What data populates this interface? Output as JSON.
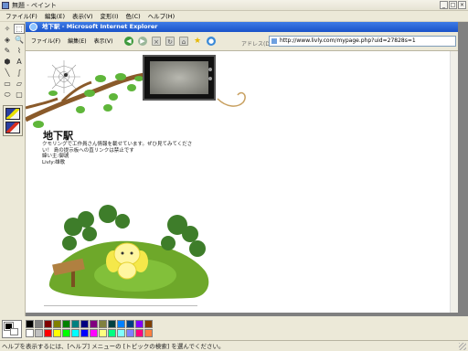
{
  "paint": {
    "title": "無題 - ペイント",
    "window_buttons": [
      "_",
      "□",
      "×"
    ],
    "menu": [
      "ファイル(F)",
      "編集(E)",
      "表示(V)",
      "変形(I)",
      "色(C)",
      "ヘルプ(H)"
    ],
    "tools": [
      "✧",
      "⬚",
      "◈",
      "🔍",
      "✎",
      "⌇",
      "⬢",
      "A",
      "╲",
      "∫",
      "▭",
      "▱",
      "⬭",
      "▢"
    ],
    "status": "ヘルプを表示するには、[ヘルプ] メニューの [トピックの検索] を選んでください。",
    "palette_colors": [
      "#000000",
      "#808080",
      "#800000",
      "#808000",
      "#008000",
      "#008080",
      "#000080",
      "#800080",
      "#808040",
      "#004040",
      "#0080ff",
      "#004080",
      "#8000ff",
      "#804000",
      "#ffffff",
      "#c0c0c0",
      "#ff0000",
      "#ffff00",
      "#00ff00",
      "#00ffff",
      "#0000ff",
      "#ff00ff",
      "#ffff80",
      "#00ff80",
      "#80ffff",
      "#8080ff",
      "#ff0080",
      "#ff8040"
    ]
  },
  "ie": {
    "title": "地下駅 - Microsoft Internet Explorer",
    "menu": [
      "ファイル(F)",
      "編集(E)",
      "表示(V)"
    ],
    "address_label": "アドレス(D)",
    "url": "http://www.livly.com/mypage.php?uid=27828s=1"
  },
  "page": {
    "title": "地下駅",
    "desc": [
      "クモリングで工作員さん情報を載せています。ぜひ見てみてくださ",
      "い！ 島の提示板への直リンクは禁止です",
      "緯い主:御琥",
      "Livly:雄歌"
    ]
  },
  "colors": {
    "ie_title": "#1a53c9",
    "grass": "#6ea82a",
    "tree": "#3e7d2a",
    "livly_yellow": "#f5e84a"
  }
}
